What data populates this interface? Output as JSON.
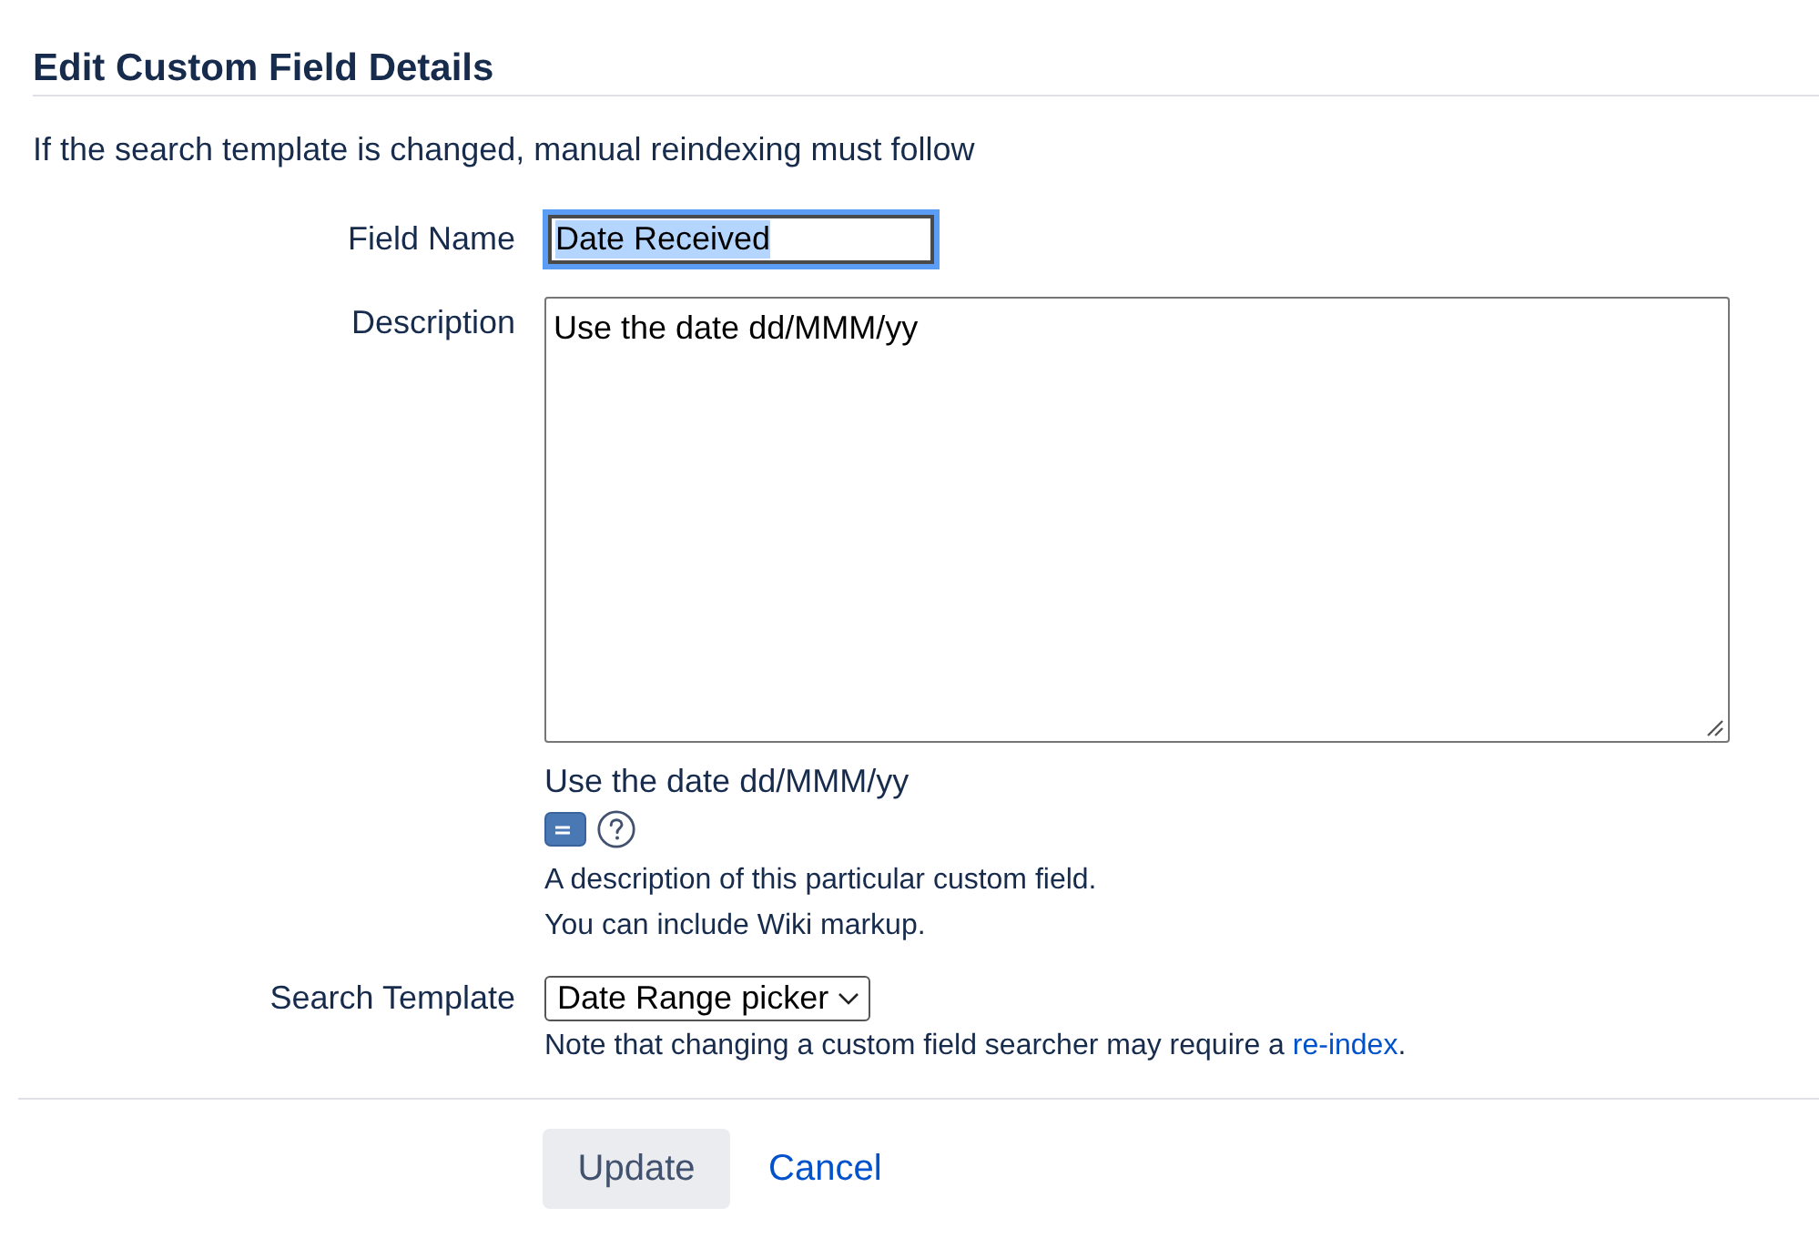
{
  "heading": "Edit Custom Field Details",
  "notice": "If the search template is changed, manual reindexing must follow",
  "fields": [
    {
      "kind": "text",
      "label": "Field Name",
      "value": "Date Received",
      "focused": true,
      "value_selected": true
    },
    {
      "kind": "textarea",
      "label": "Description",
      "value": "Use the date dd/MMM/yy",
      "preview": "Use the date dd/MMM/yy",
      "help": [
        "A description of this particular custom field.",
        "You can include Wiki markup."
      ]
    },
    {
      "kind": "select",
      "label": "Search Template",
      "value": "Date Range picker",
      "note": {
        "text": "Note that changing a custom field searcher may require a",
        "link": "re-index",
        "end": "."
      }
    }
  ],
  "actions": [
    {
      "kind": "button",
      "label": "Update"
    },
    {
      "kind": "link",
      "label": "Cancel"
    }
  ]
}
